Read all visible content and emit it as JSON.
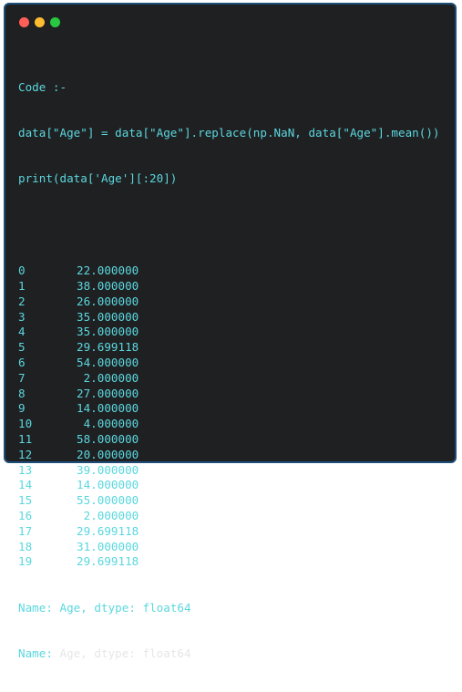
{
  "colors": {
    "background": "#1f2022",
    "border": "#1d4e78",
    "dot_red": "#ff5f57",
    "dot_yellow": "#febc2e",
    "dot_green": "#28c840",
    "cyan_text": "#5bd7de",
    "plain_text": "#e6e6e6"
  },
  "code": {
    "heading": "Code :-",
    "line1": "data[\"Age\"] = data[\"Age\"].replace(np.NaN, data[\"Age\"].mean())",
    "line2": "print(data['Age'][:20])"
  },
  "output": {
    "rows": [
      {
        "index": "0",
        "value": "22.000000"
      },
      {
        "index": "1",
        "value": "38.000000"
      },
      {
        "index": "2",
        "value": "26.000000"
      },
      {
        "index": "3",
        "value": "35.000000"
      },
      {
        "index": "4",
        "value": "35.000000"
      },
      {
        "index": "5",
        "value": "29.699118"
      },
      {
        "index": "6",
        "value": "54.000000"
      },
      {
        "index": "7",
        "value": " 2.000000"
      },
      {
        "index": "8",
        "value": "27.000000"
      },
      {
        "index": "9",
        "value": "14.000000"
      },
      {
        "index": "10",
        "value": " 4.000000"
      },
      {
        "index": "11",
        "value": "58.000000"
      },
      {
        "index": "12",
        "value": "20.000000"
      },
      {
        "index": "13",
        "value": "39.000000"
      },
      {
        "index": "14",
        "value": "14.000000"
      },
      {
        "index": "15",
        "value": "55.000000"
      },
      {
        "index": "16",
        "value": " 2.000000"
      },
      {
        "index": "17",
        "value": "29.699118"
      },
      {
        "index": "18",
        "value": "31.000000"
      },
      {
        "index": "19",
        "value": "29.699118"
      }
    ],
    "footer1_label": "Name:",
    "footer1_rest": " Age, dtype: float64",
    "footer2_label": "Name:",
    "footer2_rest": " Age, dtype: float64"
  }
}
